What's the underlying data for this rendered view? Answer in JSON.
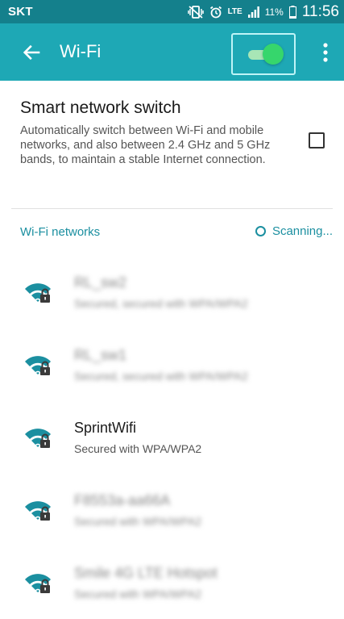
{
  "status_bar": {
    "carrier": "SKT",
    "network_type": "LTE",
    "battery": "11%",
    "time": "11:56",
    "icons": [
      "mute-vibrate-icon",
      "alarm-icon",
      "lte-icon",
      "signal-icon",
      "battery-icon"
    ]
  },
  "toolbar": {
    "title": "Wi-Fi",
    "wifi_enabled": true,
    "icons": [
      "back-arrow-icon",
      "more-vert-icon"
    ]
  },
  "smart_switch": {
    "title": "Smart network switch",
    "description": "Automatically switch between Wi-Fi and mobile networks, and also between 2.4 GHz and 5 GHz bands, to maintain a stable Internet connection.",
    "checked": false
  },
  "networks_header": {
    "label": "Wi-Fi networks",
    "status": "Scanning..."
  },
  "networks": [
    {
      "name": "RL_sw2",
      "detail": "Secured, secured with WPA/WPA2",
      "blurred": true
    },
    {
      "name": "RL_sw1",
      "detail": "Secured, secured with WPA/WPA2",
      "blurred": true
    },
    {
      "name": "SprintWifi",
      "detail": "Secured with WPA/WPA2",
      "blurred": false
    },
    {
      "name": "F8553a-aa66A",
      "detail": "Secured with WPA/WPA2",
      "blurred": true
    },
    {
      "name": "Smile 4G LTE Hotspot",
      "detail": "Secured with WPA/WPA2",
      "blurred": true
    }
  ],
  "colors": {
    "status_bar": "#14808c",
    "toolbar": "#1ea8b5",
    "accent": "#1b8fa0",
    "toggle_on": "#36d66c"
  }
}
